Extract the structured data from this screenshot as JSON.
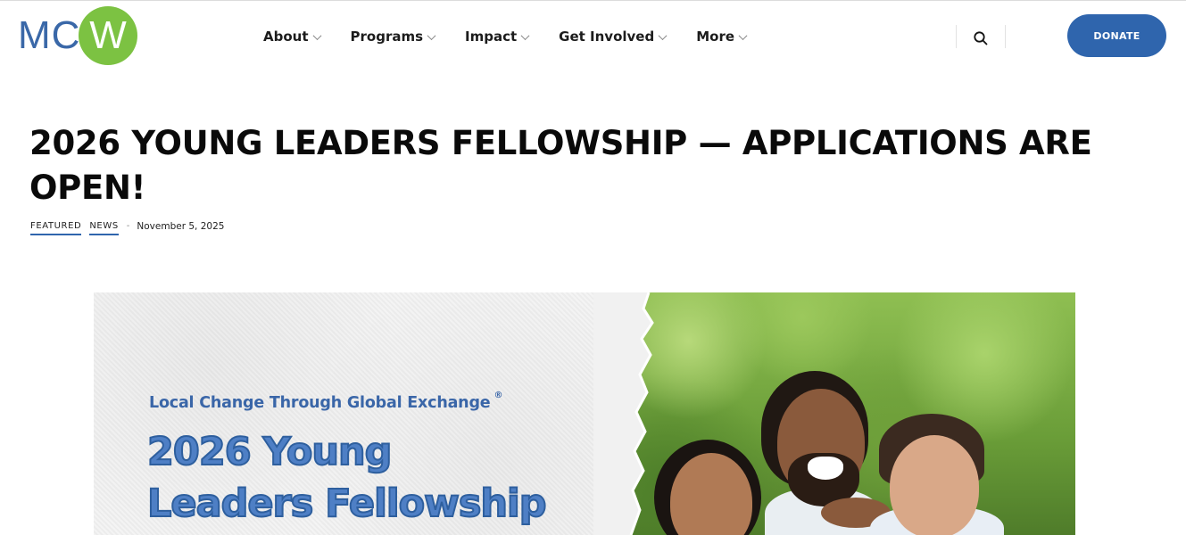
{
  "site": {
    "logo": {
      "left_text": "MC",
      "circle_text": "W",
      "brand_color": "#3a68a8",
      "circle_color": "#7cc242"
    }
  },
  "nav": {
    "items": [
      {
        "label": "About"
      },
      {
        "label": "Programs"
      },
      {
        "label": "Impact"
      },
      {
        "label": "Get Involved"
      },
      {
        "label": "More"
      }
    ],
    "search_icon": "search-icon",
    "donate_label": "DONATE",
    "donate_color": "#2f65ad"
  },
  "article": {
    "title": "2026 YOUNG LEADERS FELLOWSHIP — APPLICATIONS ARE OPEN!",
    "categories": [
      "FEATURED",
      "NEWS"
    ],
    "separator": "-",
    "date": "November 5, 2025",
    "accent_color": "#2f65ad"
  },
  "hero": {
    "tagline": "Local Change Through Global Exchange",
    "registered_mark": "®",
    "title_line1": "2026 Young",
    "title_line2": "Leaders Fellowship",
    "title_color": "#4e7fc5"
  }
}
